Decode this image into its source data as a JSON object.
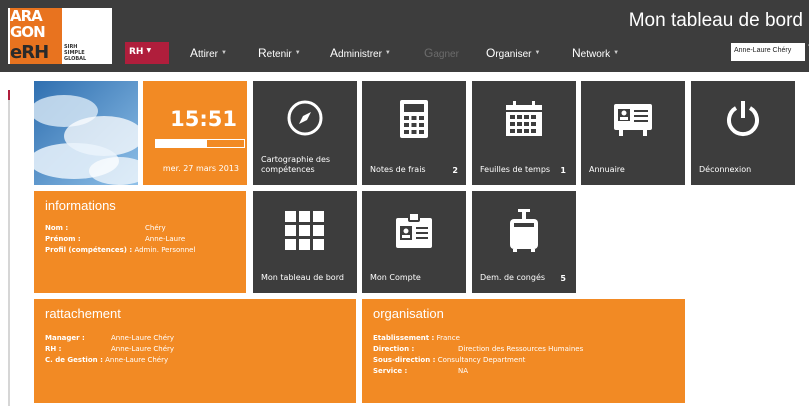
{
  "logo": {
    "line1": "ARA",
    "line2": "GON",
    "line3": "eRH",
    "sub1": "SIRH",
    "sub2": "SIMPLE",
    "sub3": "GLOBAL"
  },
  "header": {
    "page_title": "Mon tableau de bord",
    "user_name": "Anne-Laure Chéry"
  },
  "nav": {
    "rh_label": "RH",
    "items": [
      {
        "first": "A",
        "rest": "ttirer",
        "disabled": false
      },
      {
        "first": "R",
        "rest": "etenir",
        "disabled": false
      },
      {
        "first": "A",
        "rest": "dministrer",
        "disabled": false
      },
      {
        "first": "G",
        "rest": "agner",
        "disabled": true
      },
      {
        "first": "O",
        "rest": "rganiser",
        "disabled": false
      },
      {
        "first": "N",
        "rest": "etwork",
        "disabled": false
      }
    ]
  },
  "clock": {
    "time": "15:51",
    "date": "mer. 27 mars 2013",
    "progress_fraction": 0.58
  },
  "tiles": {
    "cartographie": {
      "label_line1": "Cartographie des",
      "label_line2": "compétences",
      "icon": "compass-icon"
    },
    "notes_frais": {
      "label": "Notes de frais",
      "count": "2",
      "icon": "calculator-icon"
    },
    "feuilles_temps": {
      "label": "Feuilles de temps",
      "count": "1",
      "icon": "calendar-icon"
    },
    "annuaire": {
      "label": "Annuaire",
      "icon": "contact-card-icon"
    },
    "deconnexion": {
      "label": "Déconnexion",
      "icon": "power-icon"
    },
    "tableau_bord": {
      "label": "Mon tableau de bord",
      "icon": "grid-icon"
    },
    "mon_compte": {
      "label": "Mon Compte",
      "icon": "id-badge-icon"
    },
    "conges": {
      "label": "Dem. de congés",
      "count": "5",
      "icon": "suitcase-icon"
    }
  },
  "informations": {
    "title": "informations",
    "rows": [
      {
        "key": "Nom :",
        "value": "Chéry"
      },
      {
        "key": "Prénom :",
        "value": "Anne-Laure"
      },
      {
        "key": "Profil (compétences) :",
        "value": "Admin. Personnel"
      }
    ]
  },
  "rattachement": {
    "title": "rattachement",
    "rows": [
      {
        "key": "Manager :",
        "value": "Anne-Laure Chéry"
      },
      {
        "key": "RH :",
        "value": "Anne-Laure Chéry"
      },
      {
        "key": "C. de Gestion :",
        "value": "Anne-Laure Chéry"
      }
    ]
  },
  "organisation": {
    "title": "organisation",
    "rows": [
      {
        "key": "Etablissement :",
        "value": "France"
      },
      {
        "key": "Direction :",
        "value": "Direction des Ressources Humaines"
      },
      {
        "key": "Sous-direction :",
        "value": "Consultancy Department"
      },
      {
        "key": "Service :",
        "value": "NA"
      }
    ]
  },
  "colors": {
    "dark_tile": "#3d3d3d",
    "orange_tile": "#f28a24",
    "accent_red": "#b01e3c",
    "logo_orange": "#e8731f"
  }
}
